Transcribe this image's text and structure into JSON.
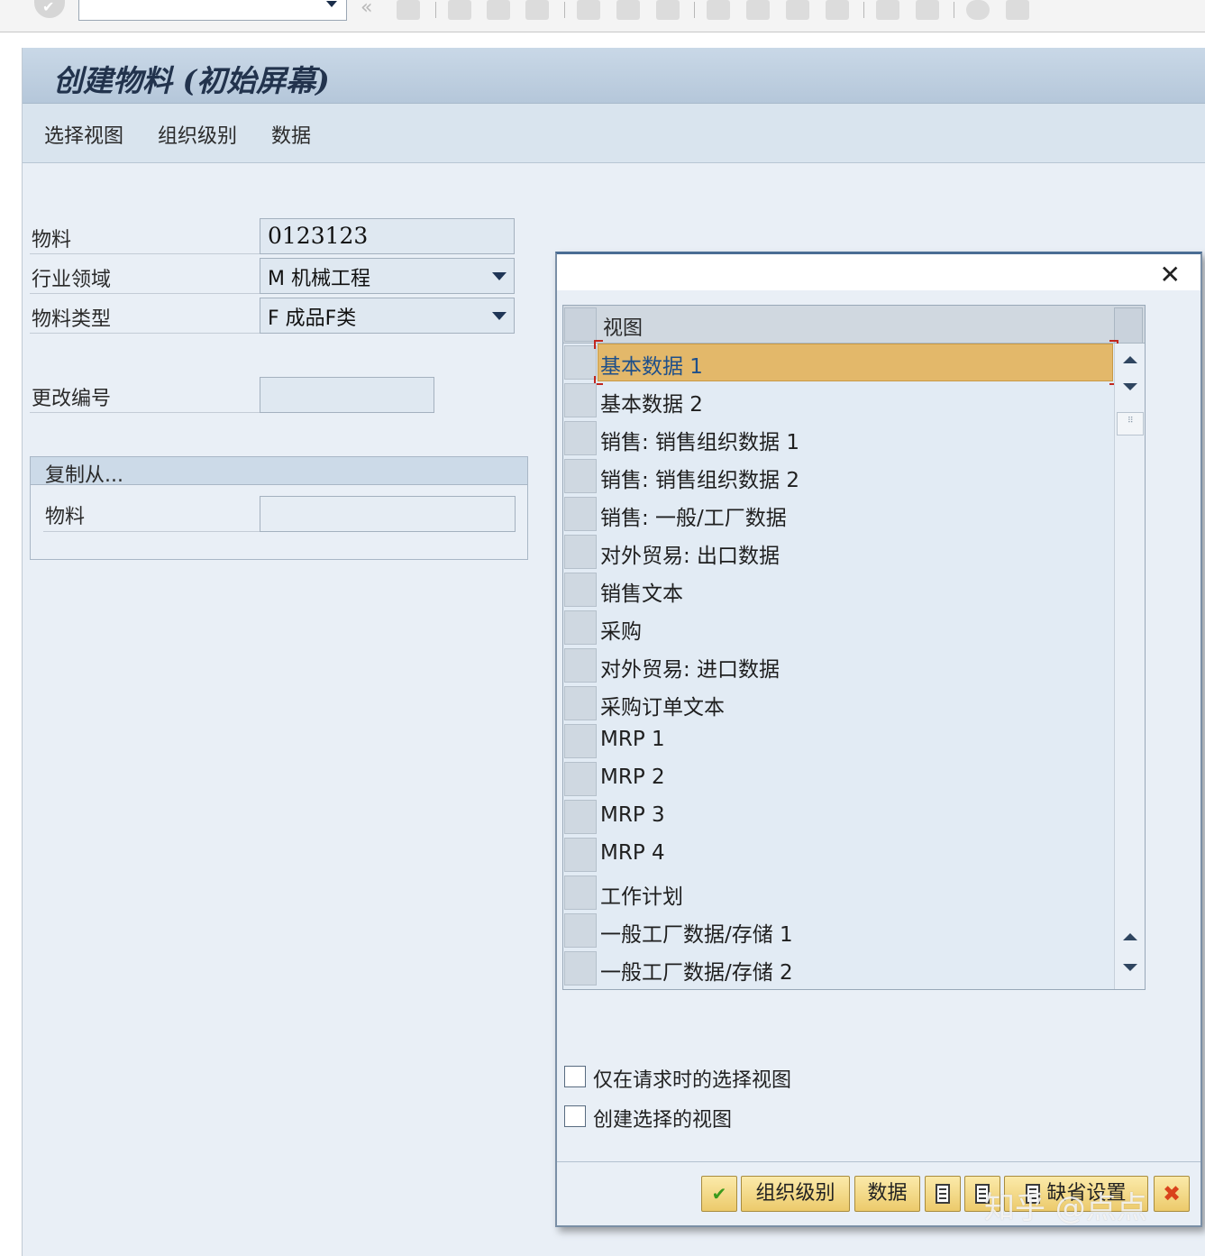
{
  "toolbar": {
    "items": [
      "ok-icon",
      "back-double-icon",
      "save-icon",
      "back-icon",
      "exit-icon",
      "cancel-icon",
      "print-icon",
      "find-icon",
      "find-next-icon",
      "first-page-icon",
      "previous-page-icon",
      "next-page-icon",
      "last-page-icon",
      "new-session-icon",
      "shortcut-icon",
      "help-icon",
      "layout-icon"
    ]
  },
  "title": "创建物料 (初始屏幕)",
  "menu": [
    "选择视图",
    "组织级别",
    "数据"
  ],
  "form": {
    "material_label": "物料",
    "material_value": "0123123",
    "industry_label": "行业领域",
    "industry_value": "M 机械工程",
    "mattype_label": "物料类型",
    "mattype_value": "F 成品F类",
    "change_label": "更改编号",
    "change_value": "",
    "copy_group_title": "复制从...",
    "copy_material_label": "物料",
    "copy_material_value": ""
  },
  "dialog": {
    "column_header": "视图",
    "rows": [
      "基本数据 1",
      "基本数据 2",
      "销售: 销售组织数据 1",
      "销售: 销售组织数据 2",
      "销售: 一般/工厂数据",
      "对外贸易: 出口数据",
      "销售文本",
      "采购",
      "对外贸易: 进口数据",
      "采购订单文本",
      "MRP 1",
      "MRP 2",
      "MRP 3",
      "MRP 4",
      "工作计划",
      "一般工厂数据/存储 1",
      "一般工厂数据/存储 2"
    ],
    "selected_row_index": 0,
    "checkbox_request": "仅在请求时的选择视图",
    "checkbox_create": "创建选择的视图",
    "btn_org": "组织级别",
    "btn_data": "数据",
    "btn_default": "缺省设置",
    "close_symbol": "✕"
  },
  "watermark": "知乎 @点点",
  "colors": {
    "title_bar": "#c9d8e7",
    "background": "#e9eff6",
    "selected_row": "#e3b86a",
    "button": "#f3d98a"
  }
}
